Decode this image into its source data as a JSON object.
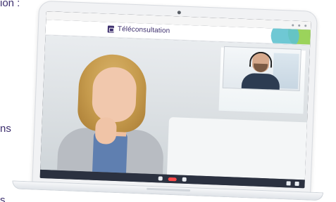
{
  "page": {
    "left_text": [
      "ion :",
      "ns",
      "s"
    ]
  },
  "app": {
    "title": "Téléconsultation",
    "logo": "teleconsultation-logo-icon"
  },
  "colors": {
    "brand": "#3d2f6e",
    "accent_green": "#9bd35b",
    "accent_teal": "#5fc2cf",
    "end_call": "#ff4b4b"
  },
  "video_call": {
    "remote_participant": "patient",
    "local_participant": "doctor"
  }
}
